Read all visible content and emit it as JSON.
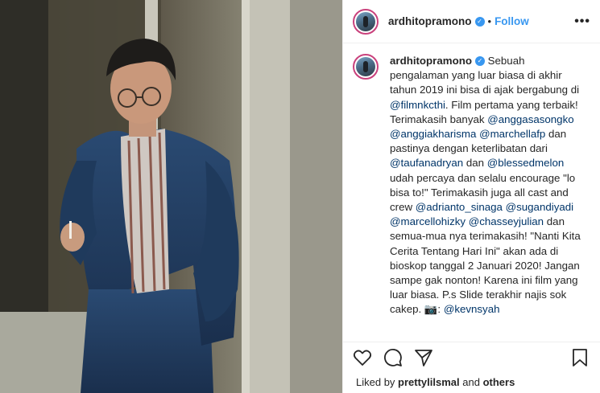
{
  "post": {
    "image_alt": "photo",
    "username": "ardhitopramono",
    "follow_label": "Follow",
    "separator": "•",
    "more_label": "•••",
    "verified_symbol": "✓"
  },
  "caption": {
    "username": "ardhitopramono",
    "parts": [
      {
        "t": " Sebuah pengalaman yang luar biasa di akhir tahun 2019 ini bisa di ajak bergabung di ",
        "m": false
      },
      {
        "t": "@filmnkcthi",
        "m": true
      },
      {
        "t": ". Film pertama yang terbaik! Terimakasih banyak ",
        "m": false
      },
      {
        "t": "@anggasasongko",
        "m": true
      },
      {
        "t": " ",
        "m": false
      },
      {
        "t": "@anggiakharisma",
        "m": true
      },
      {
        "t": " ",
        "m": false
      },
      {
        "t": "@marchellafp",
        "m": true
      },
      {
        "t": " dan pastinya dengan keterlibatan dari ",
        "m": false
      },
      {
        "t": "@taufanadryan",
        "m": true
      },
      {
        "t": " dan ",
        "m": false
      },
      {
        "t": "@blessedmelon",
        "m": true
      },
      {
        "t": " udah percaya dan selalu encourage \"lo bisa to!\" Terimakasih juga all cast and crew ",
        "m": false
      },
      {
        "t": "@adrianto_sinaga",
        "m": true
      },
      {
        "t": " ",
        "m": false
      },
      {
        "t": "@sugandiyadi",
        "m": true
      },
      {
        "t": " ",
        "m": false
      },
      {
        "t": "@marcellohizky",
        "m": true
      },
      {
        "t": " ",
        "m": false
      },
      {
        "t": "@chasseyjulian",
        "m": true
      },
      {
        "t": " dan semua-mua nya terimakasih! \"Nanti Kita Cerita Tentang Hari Ini\" akan ada di bioskop tanggal 2 Januari 2020! Jangan sampe gak nonton! Karena ini film yang luar biasa. P.s Slide terakhir najis sok cakep. 📷: ",
        "m": false
      },
      {
        "t": "@kevnsyah",
        "m": true
      }
    ]
  },
  "actions": {
    "like_icon": "heart-icon",
    "comment_icon": "comment-icon",
    "share_icon": "share-icon",
    "save_icon": "bookmark-icon"
  },
  "likes": {
    "prefix": "Liked by ",
    "user": "prettylilsmal",
    "middle": " and ",
    "others": "others"
  },
  "colors": {
    "accent": "#3897f0",
    "mention": "#003569",
    "border": "#efefef",
    "suit": "#1f3a5c"
  }
}
